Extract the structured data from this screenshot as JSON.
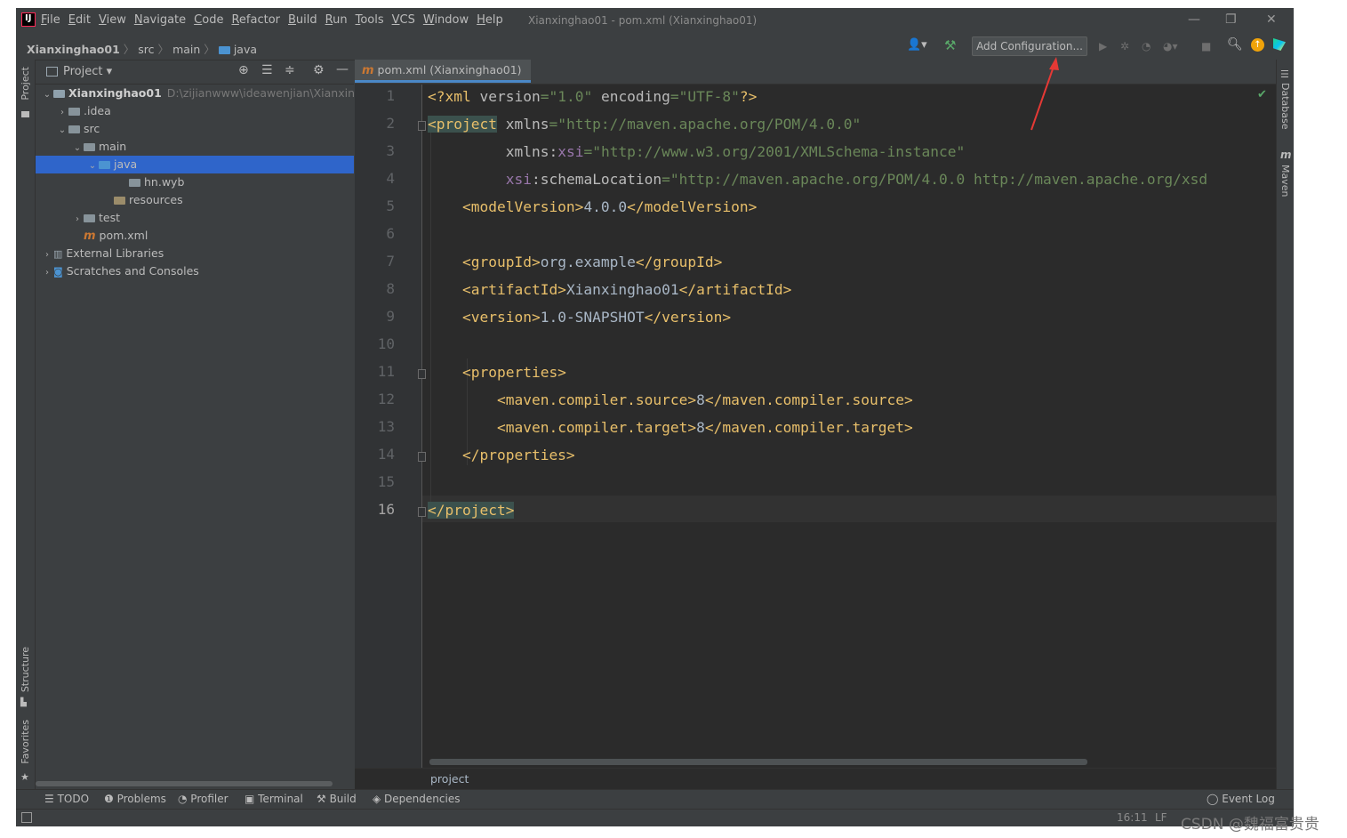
{
  "menu": [
    "File",
    "Edit",
    "View",
    "Navigate",
    "Code",
    "Refactor",
    "Build",
    "Run",
    "Tools",
    "VCS",
    "Window",
    "Help"
  ],
  "window_title": "Xianxinghao01 - pom.xml (Xianxinghao01)",
  "breadcrumb": {
    "project": "Xianxinghao01",
    "items": [
      "src",
      "main",
      "java"
    ]
  },
  "toolbar": {
    "add_configuration": "Add Configuration..."
  },
  "side_tabs": {
    "project": "Project",
    "structure": "Structure",
    "favorites": "Favorites",
    "database": "Database",
    "maven": "Maven"
  },
  "project_panel": {
    "title": "Project"
  },
  "tree": [
    {
      "label": "Xianxinghao01",
      "path": "D:\\zijianwww\\ideawenjian\\Xianxingha",
      "depth": 0,
      "chev": "v",
      "icon": "module"
    },
    {
      "label": ".idea",
      "depth": 1,
      "chev": ">",
      "icon": "folder"
    },
    {
      "label": "src",
      "depth": 1,
      "chev": "v",
      "icon": "folder"
    },
    {
      "label": "main",
      "depth": 2,
      "chev": "v",
      "icon": "folder"
    },
    {
      "label": "java",
      "depth": 3,
      "chev": "v",
      "icon": "folder-blue",
      "selected": true
    },
    {
      "label": "hn.wyb",
      "depth": 5,
      "chev": "",
      "icon": "package"
    },
    {
      "label": "resources",
      "depth": 4,
      "chev": "",
      "icon": "resources"
    },
    {
      "label": "test",
      "depth": 2,
      "chev": ">",
      "icon": "folder"
    },
    {
      "label": "pom.xml",
      "depth": 2,
      "chev": "",
      "icon": "maven"
    },
    {
      "label": "External Libraries",
      "depth": 0,
      "chev": ">",
      "icon": "libraries"
    },
    {
      "label": "Scratches and Consoles",
      "depth": 0,
      "chev": ">",
      "icon": "scratches"
    }
  ],
  "editor": {
    "tab_label": "pom.xml (Xianxinghao01)",
    "line_numbers": [
      "1",
      "2",
      "3",
      "4",
      "5",
      "6",
      "7",
      "8",
      "9",
      "10",
      "11",
      "12",
      "13",
      "14",
      "15",
      "16"
    ],
    "xml_decl": {
      "open": "<?xml ",
      "a1": "version",
      "eq1": "=",
      "v1": "\"1.0\"",
      "a2": " encoding",
      "eq2": "=",
      "v2": "\"UTF-8\"",
      "close": "?>"
    },
    "project_open": "<project",
    "xmlns_attr": " xmlns",
    "xmlns_val": "\"http://maven.apache.org/POM/4.0.0\"",
    "xsi_prefix": "xmlns:",
    "xsi_name": "xsi",
    "xsi_val": "\"http://www.w3.org/2001/XMLSchema-instance\"",
    "schema_prefix": "xsi",
    "schema_name": ":schemaLocation",
    "schema_val": "\"http://maven.apache.org/POM/4.0.0 http://maven.apache.org/xsd",
    "gt": ">",
    "model_open": "<modelVersion>",
    "model_val": "4.0.0",
    "model_close": "</modelVersion>",
    "group_open": "<groupId>",
    "group_val": "org.example",
    "group_close": "</groupId>",
    "artifact_open": "<artifactId>",
    "artifact_val": "Xianxinghao01",
    "artifact_close": "</artifactId>",
    "version_open": "<version>",
    "version_val": "1.0-SNAPSHOT",
    "version_close": "</version>",
    "props_open": "<properties>",
    "src_open": "<maven.compiler.source>",
    "src_val": "8",
    "src_close": "</maven.compiler.source>",
    "tgt_open": "<maven.compiler.target>",
    "tgt_val": "8",
    "tgt_close": "</maven.compiler.target>",
    "props_close": "</properties>",
    "project_close": "</project>",
    "breadcrumb": "project"
  },
  "tool_windows": [
    "TODO",
    "Problems",
    "Profiler",
    "Terminal",
    "Build",
    "Dependencies"
  ],
  "event_log": "Event Log",
  "status": {
    "position": "16:11",
    "line_sep": "LF"
  },
  "watermark": "CSDN @魏福富贵贵",
  "colors": {
    "tag": "#e8bf6a",
    "string": "#6a8759",
    "namespace": "#9876aa",
    "selection": "#2f65ca",
    "annotation_arrow": "#e53935"
  }
}
